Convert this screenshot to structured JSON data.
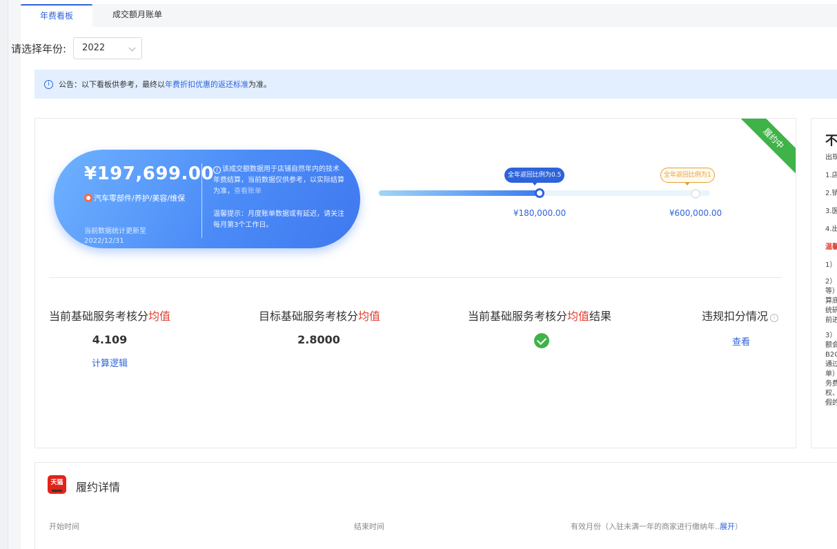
{
  "tabs": [
    {
      "label": "年费看板",
      "active": true
    },
    {
      "label": "成交额月账单",
      "active": false
    }
  ],
  "year_selector": {
    "label": "请选择年份:",
    "value": "2022"
  },
  "notice": {
    "prefix": "公告：以下看板供参考，最终以",
    "highlight": "年费折扣优惠的返还标准",
    "suffix": "为准。"
  },
  "status_ribbon": "履约中",
  "summary": {
    "amount": "¥197,699.00",
    "category": "汽车零部件/养护/美容/维保",
    "updated": "当前数据统计更新至2022/12/31",
    "desc": "该成交额数据用于店铺自然年内的技术年费结算，当前数据仅供参考，以实际结算为准，",
    "desc_link": "查看账单",
    "tip": "温馨提示：月度账单数据或有延迟，请关注每月第3个工作日。"
  },
  "progress": {
    "fill_fraction": 0.485,
    "milestones": [
      {
        "label": "全年返回比例为0.5",
        "value": "¥180,000.00"
      },
      {
        "label": "全年返回比例为1",
        "value": "¥600,000.00"
      }
    ]
  },
  "metrics": [
    {
      "label_prefix": "当前基础服务考核分",
      "label_red": "均值",
      "label_suffix": "",
      "value": "4.109",
      "link": "计算逻辑"
    },
    {
      "label_prefix": "目标基础服务考核分",
      "label_red": "均值",
      "label_suffix": "",
      "value": "2.8000"
    },
    {
      "label_prefix": "当前基础服务考核分",
      "label_red": "均值",
      "label_suffix": "结果",
      "result": "pass"
    },
    {
      "label_prefix": "违规扣分情况",
      "label_red": "",
      "label_suffix": "",
      "link": "查看"
    }
  ],
  "side_panel": {
    "title": "不",
    "lines": [
      "出现",
      "1.店",
      "2.销",
      "3.医",
      "4.出"
    ],
    "red_line": "温馨",
    "more": [
      "1）",
      "2）",
      "等）",
      "算底",
      "统研",
      "前进",
      "3）",
      "额会",
      "B2C",
      "通过",
      "单）",
      "务费",
      "权、",
      "假的"
    ]
  },
  "detail": {
    "logo_text": "天猫",
    "title": "履约详情",
    "columns": [
      {
        "label": "开始时间"
      },
      {
        "label": "结束时间"
      },
      {
        "label": "有效月份（入驻未满一年的商家进行缴纳年..",
        "link": "展开",
        "close": "）"
      }
    ]
  },
  "colors": {
    "primary": "#2e63d9",
    "success": "#3fb347",
    "danger": "#e33b2e",
    "warning": "#e8a130"
  }
}
